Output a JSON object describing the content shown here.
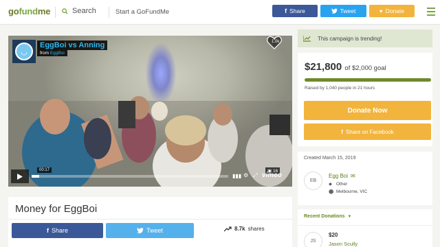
{
  "nav": {
    "logo_go": "go",
    "logo_fund": "fund",
    "logo_me": "me",
    "search_label": "Search",
    "start_label": "Start a GoFundMe",
    "share_label": "Share",
    "tweet_label": "Tweet",
    "donate_label": "Donate"
  },
  "video": {
    "title": "EggBoi vs Anning",
    "from_prefix": "from",
    "from_user": "EggBoi",
    "like_count": "1.0k",
    "time": "00:17",
    "photo_count": "16",
    "brand": "vimeo",
    "progress": 0.04
  },
  "campaign": {
    "title": "Money for EggBoi",
    "share_label": "Share",
    "tweet_label": "Tweet",
    "share_count": "8.7k",
    "share_suffix": "shares"
  },
  "sidebar": {
    "trending": "This campaign is trending!",
    "amount": "$21,800",
    "goal": "of $2,000 goal",
    "raised_text": "Raised by 1,040 people in 21 hours",
    "progress": 1.0,
    "donate_now": "Donate Now",
    "share_facebook": "Share on Facebook",
    "created": "Created March 15, 2019",
    "organizer_initials": "EB",
    "organizer_name": "Egg Boi",
    "category": "Other",
    "location": "Melbourne, VIC",
    "recent_donations_label": "Recent Donations",
    "donations": [
      {
        "initials": "JS",
        "amount": "$20",
        "name": "Jason Scully"
      }
    ]
  },
  "colors": {
    "brand_green": "#7aa542",
    "facebook": "#3b5998",
    "twitter": "#2aa3ef",
    "donate": "#f2b43c",
    "progress": "#6e8a2a"
  }
}
